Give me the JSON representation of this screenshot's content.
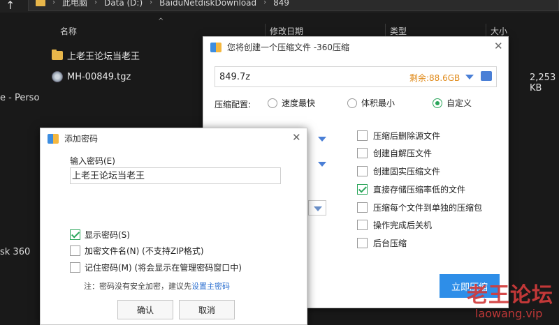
{
  "explorer": {
    "breadcrumb": [
      "此电脑",
      "Data (D:)",
      "BaiduNetdiskDownload",
      "849"
    ],
    "columns": {
      "name": "名称",
      "modified": "修改日期",
      "type": "类型",
      "size": "大小"
    },
    "files": [
      {
        "name": "上老王论坛当老王",
        "icon": "folder-icon"
      },
      {
        "name": "MH-00849.tgz",
        "icon": "archive-icon",
        "size": "2,253 KB"
      }
    ],
    "sidebar": {
      "item1": "e - Perso",
      "item2": "sk 360"
    }
  },
  "compress_dialog": {
    "title": "您将创建一个压缩文件 -360压缩",
    "filename": "849.7z",
    "free_space": "剩余:88.6GB",
    "config_label": "压缩配置:",
    "radios": [
      {
        "label": "速度最快",
        "selected": false
      },
      {
        "label": "体积最小",
        "selected": false
      },
      {
        "label": "自定义",
        "selected": true
      }
    ],
    "options": [
      {
        "label": "压缩后删除源文件",
        "checked": false
      },
      {
        "label": "创建自解压文件",
        "checked": false
      },
      {
        "label": "创建固实压缩文件",
        "checked": false
      },
      {
        "label": "直接存储压缩率低的文件",
        "checked": true
      },
      {
        "label": "压缩每个文件到单独的压缩包",
        "checked": false
      },
      {
        "label": "操作完成后关机",
        "checked": false
      },
      {
        "label": "后台压缩",
        "checked": false
      }
    ],
    "start_button": "立即压缩"
  },
  "password_dialog": {
    "title": "添加密码",
    "input_label": "输入密码(E)",
    "password_value": "上老王论坛当老王",
    "options": [
      {
        "label": "显示密码(S)",
        "checked": true
      },
      {
        "label": "加密文件名(N) (不支持ZIP格式)",
        "checked": false
      },
      {
        "label": "记住密码(M) (将会显示在管理密码窗口中)",
        "checked": false
      }
    ],
    "note_prefix": "注：密码没有安全加密，建议先",
    "note_link": "设置主密码",
    "ok_button": "确认",
    "cancel_button": "取消"
  },
  "watermark": {
    "line1": "老王论坛",
    "line2": "laowang.vip"
  },
  "colors": {
    "accent_blue": "#2e8ee8",
    "check_green": "#2aa55a",
    "free_space_orange": "#e08a1a",
    "watermark_red": "#d23b3b"
  }
}
